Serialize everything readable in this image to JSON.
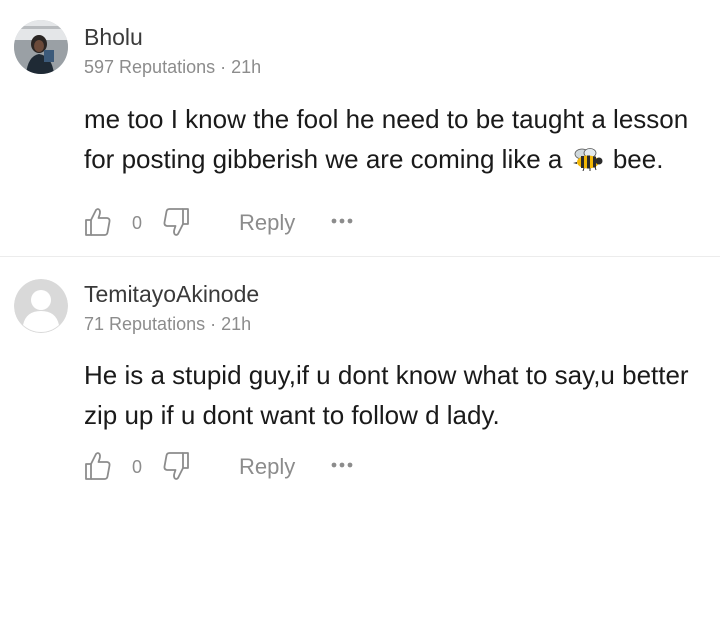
{
  "comments": [
    {
      "username": "Bholu",
      "reputation": "597 Reputations",
      "separator": "·",
      "time": "21h",
      "text_line1": "me too I know the fool he need to be taught a lesson",
      "text_line2_before": "for  posting gibberish we are coming like a",
      "text_line2_after": "bee.",
      "emoji_icon": "bee-icon",
      "like_count": "0",
      "reply_label": "Reply",
      "avatar_type": "photo"
    },
    {
      "username": "TemitayoAkinode",
      "reputation": "71 Reputations",
      "separator": "·",
      "time": "21h",
      "text_line1": "He is a stupid guy,if u dont know what to say,u better",
      "text_line2": "zip up if u dont want to follow d lady.",
      "like_count": "0",
      "reply_label": "Reply",
      "avatar_type": "default-placeholder"
    }
  ],
  "icons": {
    "like": "thumbs-up-icon",
    "dislike": "thumbs-down-icon",
    "more": "more-options-icon"
  },
  "colors": {
    "text_primary": "#1a1a1a",
    "text_secondary": "#8c8c8c",
    "divider": "#ececec",
    "placeholder_avatar": "#d9d9d9"
  }
}
